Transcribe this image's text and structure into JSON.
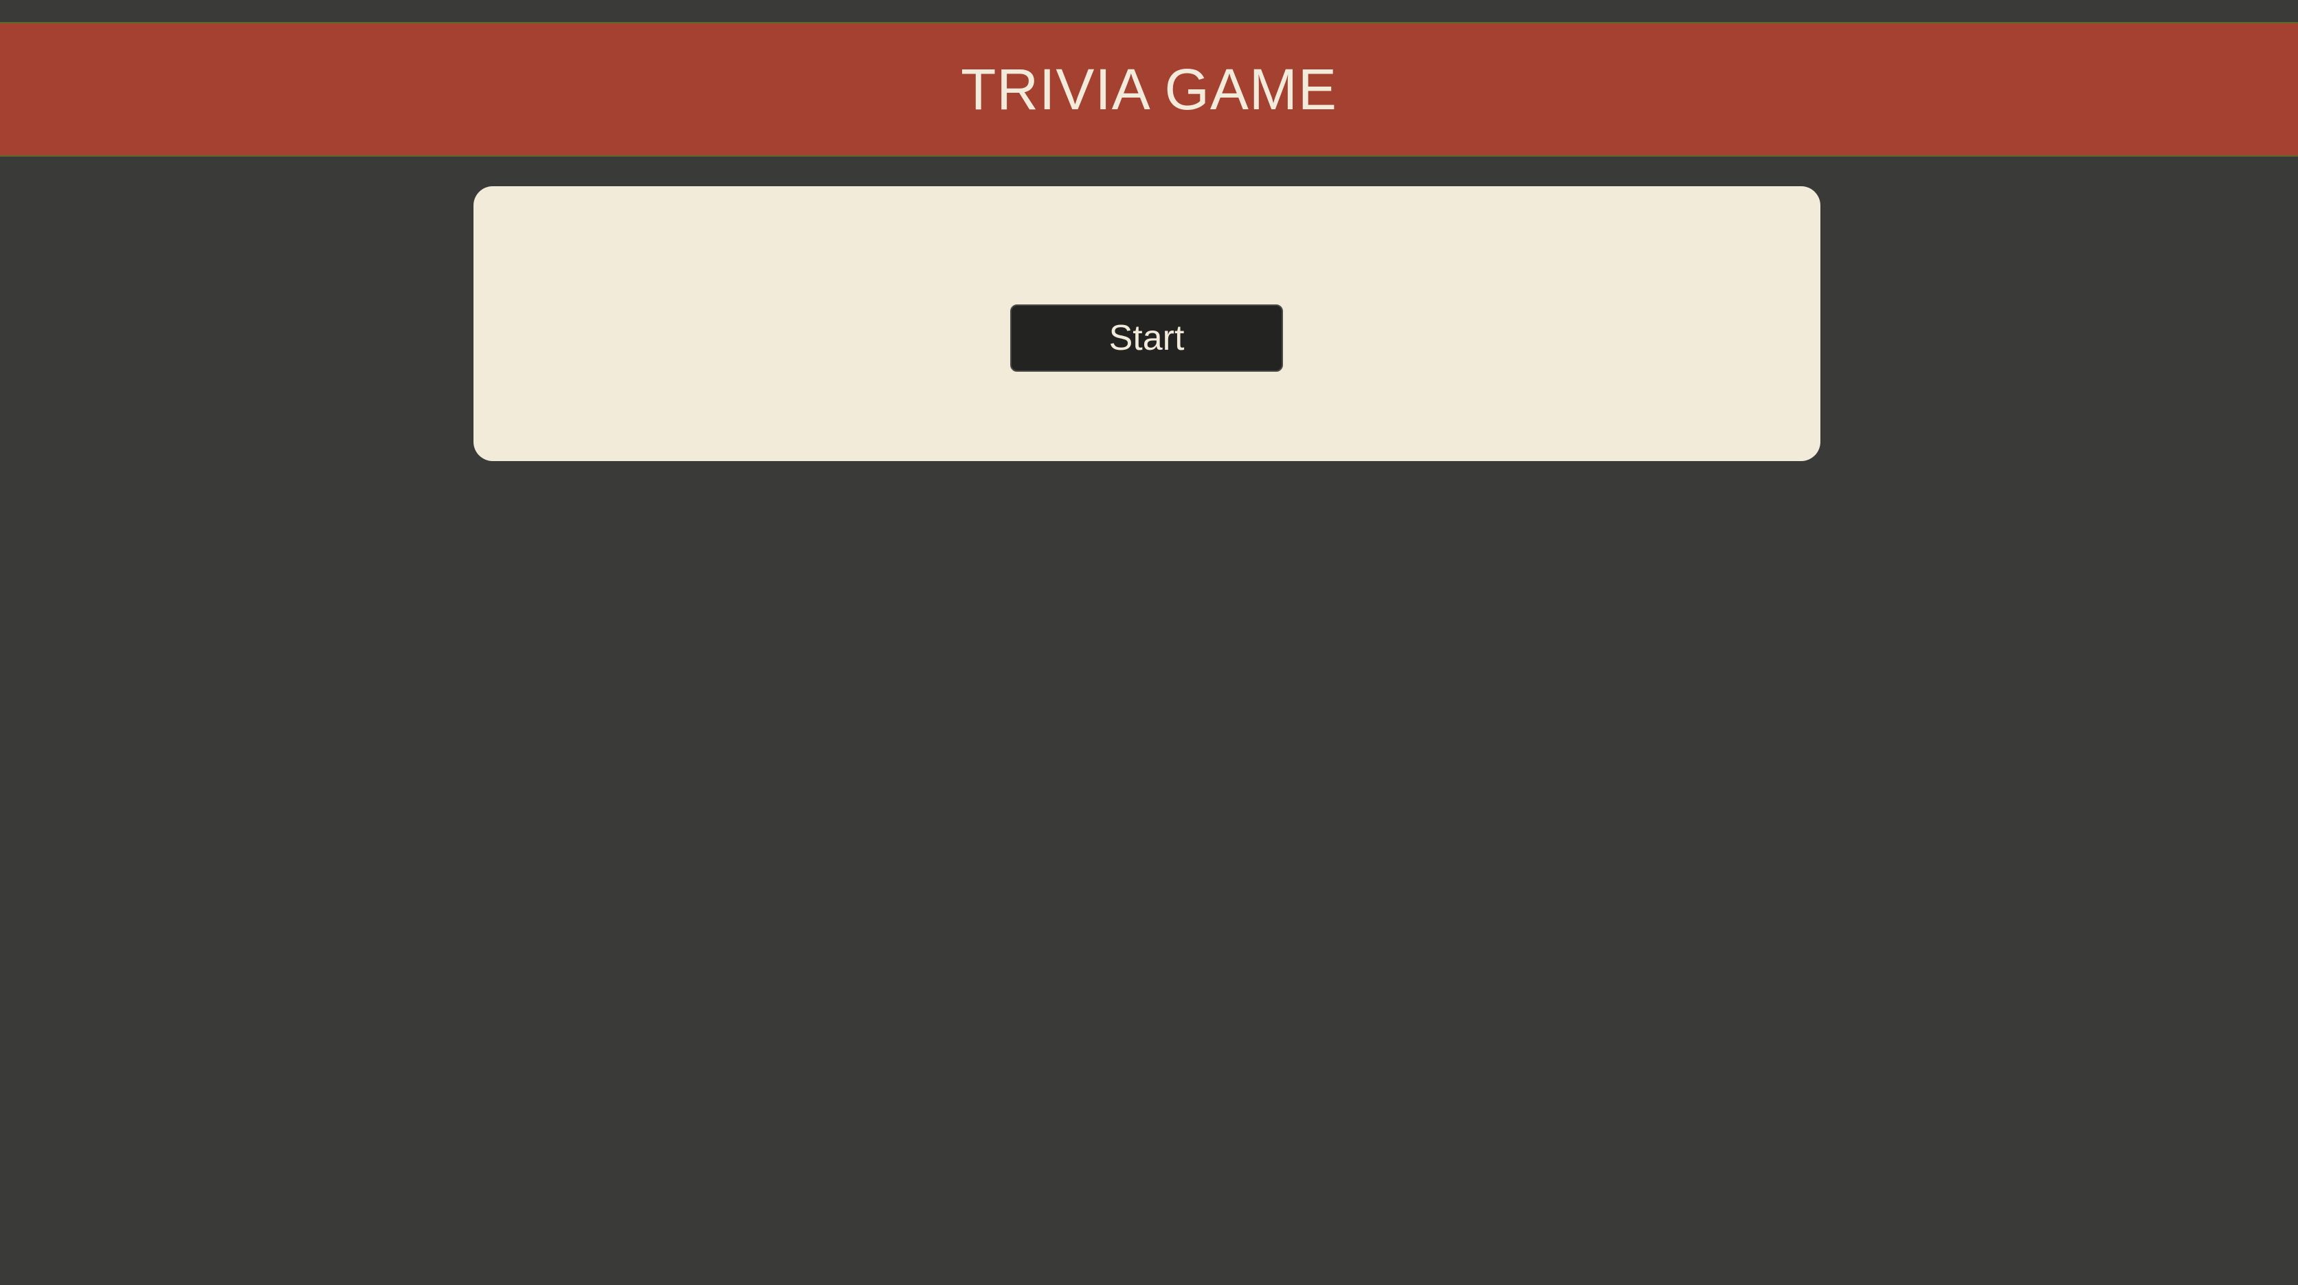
{
  "header": {
    "title": "TRIVIA GAME"
  },
  "game": {
    "start_label": "Start"
  },
  "colors": {
    "background": "#3a3a38",
    "header": "#a44130",
    "card": "#f2ebda",
    "button": "#232321",
    "text_light": "#f2eadb"
  }
}
